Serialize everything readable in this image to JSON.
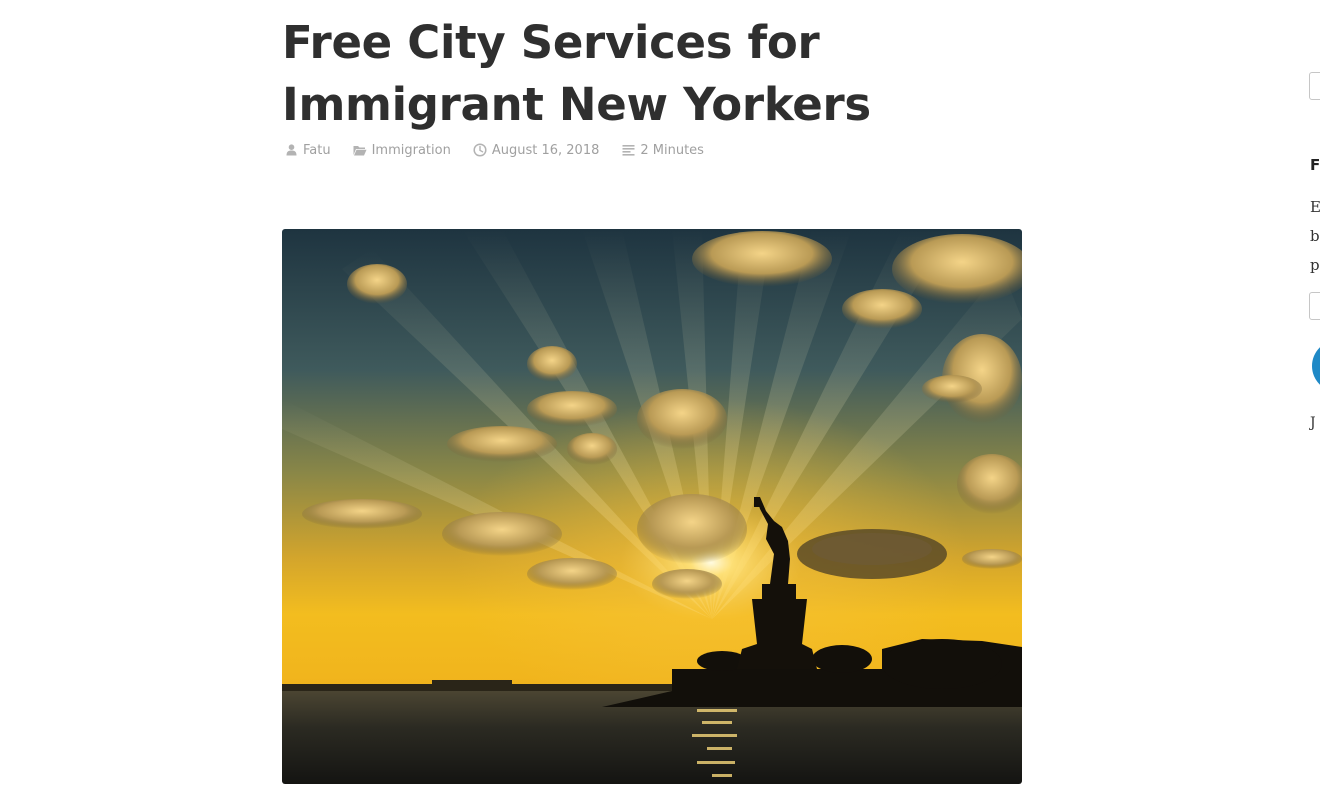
{
  "post": {
    "title": "Free City Services for Immigrant New Yorkers",
    "meta": {
      "author": "Fatu",
      "category": "Immigration",
      "date": "August 16, 2018",
      "reading_time": "2 Minutes"
    },
    "icons": {
      "author": "user-icon",
      "category": "folder-icon",
      "date": "clock-icon",
      "reading_time": "text-lines-icon"
    }
  },
  "sidebar": {
    "heading_partial": "F",
    "text_partial_lines": [
      "E",
      "bl",
      "p"
    ],
    "footer_partial": "J"
  },
  "colors": {
    "title": "#2f2f2f",
    "meta": "#a0a0a0",
    "follow_button": "#1f89c6"
  }
}
